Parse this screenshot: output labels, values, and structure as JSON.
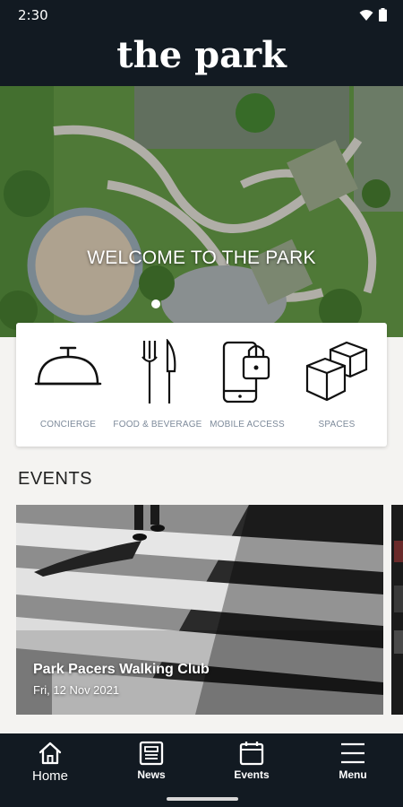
{
  "status_bar": {
    "time": "2:30"
  },
  "header": {
    "logo_text": "the park"
  },
  "hero": {
    "title": "WELCOME TO THE PARK"
  },
  "services": [
    {
      "label": "CONCIERGE",
      "icon": "concierge-bell-icon"
    },
    {
      "label": "FOOD & BEVERAGE",
      "icon": "fork-knife-icon"
    },
    {
      "label": "MOBILE ACCESS",
      "icon": "phone-lock-icon"
    },
    {
      "label": "SPACES",
      "icon": "cubes-icon"
    }
  ],
  "events": {
    "heading": "EVENTS",
    "items": [
      {
        "title": "Park Pacers Walking Club",
        "date": "Fri, 12 Nov 2021"
      }
    ]
  },
  "bottom_nav": [
    {
      "label": "Home",
      "icon": "home-icon"
    },
    {
      "label": "News",
      "icon": "news-icon"
    },
    {
      "label": "Events",
      "icon": "calendar-icon"
    },
    {
      "label": "Menu",
      "icon": "hamburger-menu-icon"
    }
  ],
  "colors": {
    "header_bg": "#121a22",
    "label_gray": "#7d8a9a",
    "page_bg": "#f4f3f1"
  }
}
